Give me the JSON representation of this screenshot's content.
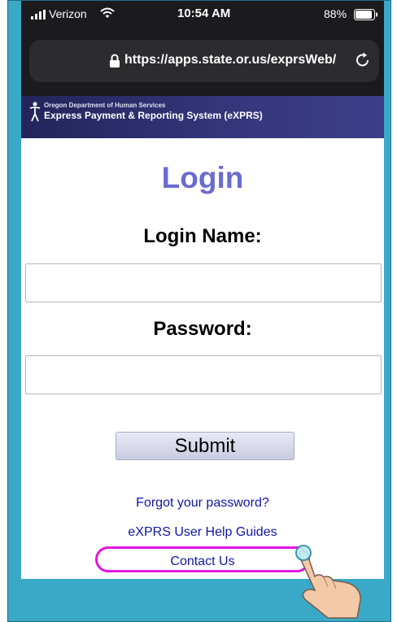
{
  "status_bar": {
    "carrier": "Verizon",
    "time": "10:54 AM",
    "battery": "88%"
  },
  "browser": {
    "url": "https://apps.state.or.us/exprsWeb/",
    "lock_icon": "lock-icon",
    "reload_icon": "reload-icon"
  },
  "banner": {
    "org": "Oregon Department of Human Services",
    "system": "Express Payment & Reporting System (eXPRS)"
  },
  "login": {
    "title": "Login",
    "name_label": "Login Name:",
    "name_value": "",
    "password_label": "Password:",
    "password_value": "",
    "submit_label": "Submit"
  },
  "links": {
    "forgot_password": "Forgot your password?",
    "help_guides": "eXPRS User Help Guides",
    "contact": "Contact Us"
  },
  "colors": {
    "frame": "#3aa9c7",
    "banner": "#2b2c6a",
    "title": "#6a6ccf",
    "link": "#1216a6",
    "highlight": "#e414e2"
  }
}
